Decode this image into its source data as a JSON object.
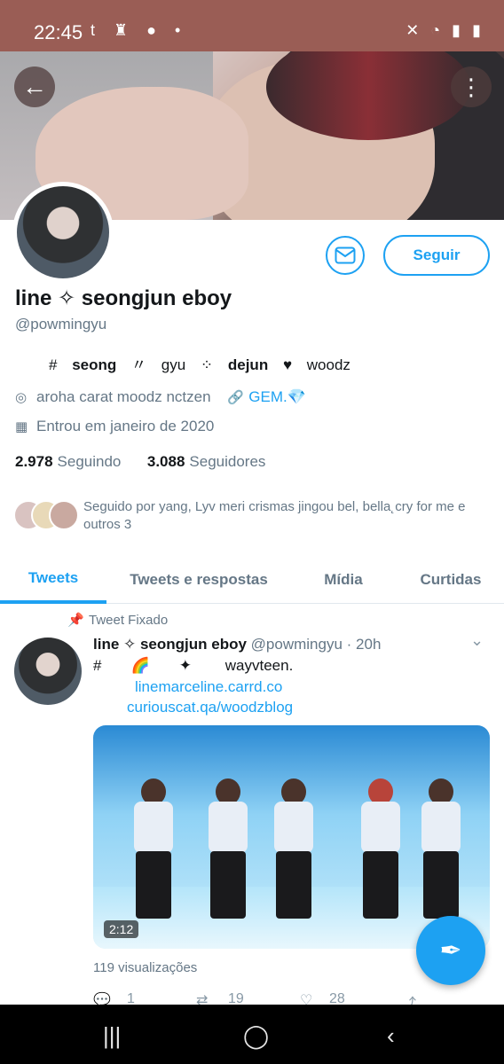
{
  "status_bar": {
    "time": "22:45",
    "left_icons": "t ♜ ● •",
    "right_icons": "✕ ◔ ▮ ▮"
  },
  "header": {
    "back_icon": "←",
    "more_icon": "⋮"
  },
  "profile": {
    "name": "line ✧ seongjun eboy",
    "handle": "@powmingyu",
    "follow_label": "Seguir",
    "bio": {
      "hash": "#",
      "seong": "seong",
      "sep1": "〃",
      "gyu": "gyu",
      "sep2": "⁘",
      "dejun": "dejun",
      "heart": "♥",
      "woodz": "woodz"
    },
    "location": "aroha carat moodz nctzen",
    "link": "GEM.💎",
    "joined": "Entrou em janeiro de 2020",
    "following_count": "2.978",
    "following_label": "Seguindo",
    "followers_count": "3.088",
    "followers_label": "Seguidores",
    "followed_by": "Seguido por yang, Lyv meri crismas jingou bel, bella˛cry for me e outros 3"
  },
  "tabs": [
    "Tweets",
    "Tweets e respostas",
    "Mídia",
    "Curtidas"
  ],
  "pinned_label": "Tweet Fixado",
  "tweet": {
    "name": "line ✧ seongjun eboy",
    "handle": "@powmingyu",
    "time": "· 20h",
    "line1": "#       🌈       ✦        wayvteen.",
    "link1": "linemarceline.carrd.co",
    "link2": "curiouscat.qa/woodzblog",
    "duration": "2:12",
    "views": "119 visualizações",
    "replies": "1",
    "retweets": "19",
    "likes": "28"
  },
  "colors": {
    "accent": "#1da1f2",
    "status_bar": "#9a5d55"
  }
}
